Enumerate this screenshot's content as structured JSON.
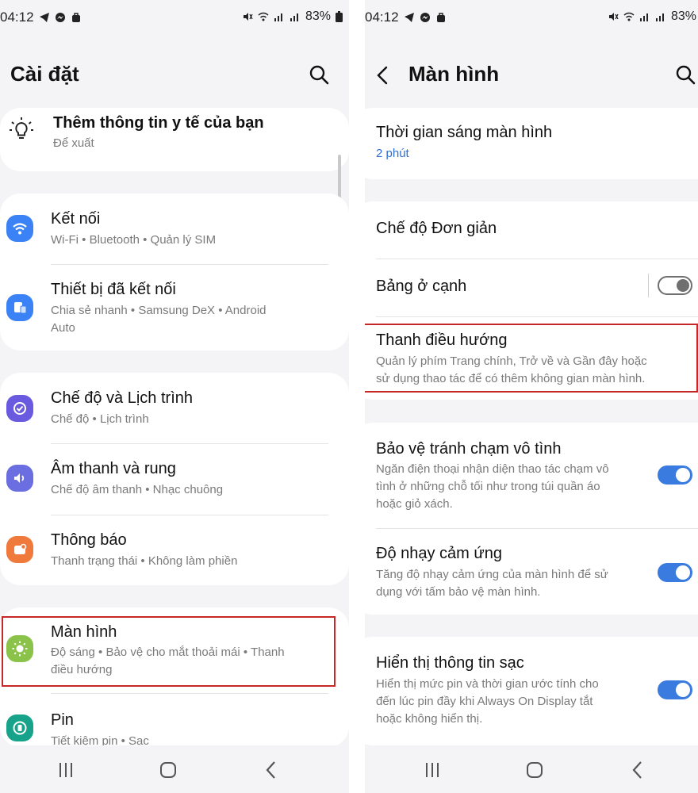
{
  "status": {
    "time": "04:12",
    "battery": "83%"
  },
  "left": {
    "title": "Cài đặt",
    "suggestion": {
      "title": "Thêm thông tin y tế của bạn",
      "sub": "Để xuất"
    },
    "items": [
      {
        "title": "Kết nối",
        "sub": "Wi-Fi  •  Bluetooth  •  Quản lý SIM",
        "color": "#3b82f6"
      },
      {
        "title": "Thiết bị đã kết nối",
        "sub1": "Chia sẻ nhanh  •  Samsung DeX  •  Android",
        "sub2": "Auto",
        "color": "#3b82f6"
      },
      {
        "title": "Chế độ và Lịch trình",
        "sub": "Chế độ  •  Lịch trình",
        "color": "#6a5adf"
      },
      {
        "title": "Âm thanh và rung",
        "sub": "Chế độ âm thanh  •  Nhạc chuông",
        "color": "#6a6ee0"
      },
      {
        "title": "Thông báo",
        "sub": "Thanh trạng thái  •  Không làm phiền",
        "color": "#f07a3c"
      },
      {
        "title": "Màn hình",
        "sub1": "Độ sáng  •  Bảo vệ cho mắt thoải mái  •  Thanh",
        "sub2": "điều hướng",
        "color": "#8bc34a"
      },
      {
        "title": "Pin",
        "sub": "Tiết kiệm pin  •  Sạc",
        "color": "#16a38a"
      }
    ]
  },
  "right": {
    "title": "Màn hình",
    "screen_timeout": {
      "title": "Thời gian sáng màn hình",
      "value": "2 phút"
    },
    "easy_mode": {
      "title": "Chế độ Đơn giản"
    },
    "edge_panels": {
      "title": "Bảng ở cạnh",
      "enabled": false
    },
    "navigation_bar": {
      "title": "Thanh điều hướng",
      "sub1": "Quản lý phím Trang chính, Trở về và Gần đây hoặc",
      "sub2": "sử dụng thao tác để có thêm không gian màn hình."
    },
    "accidental_touch": {
      "title": "Bảo vệ tránh chạm vô tình",
      "sub1": "Ngăn điện thoại nhận diện thao tác chạm vô",
      "sub2": "tình ở những chỗ tối như trong túi quần áo",
      "sub3": "hoặc giỏ xách.",
      "enabled": true
    },
    "touch_sensitivity": {
      "title": "Độ nhạy cảm ứng",
      "sub1": "Tăng độ nhạy cảm ứng của màn hình để sử",
      "sub2": "dụng với tấm bảo vệ màn hình.",
      "enabled": true
    },
    "charging_info": {
      "title": "Hiển thị thông tin sạc",
      "sub1": "Hiển thị mức pin và thời gian ước tính cho",
      "sub2": "đến lúc pin đầy khi Always On Display tắt",
      "sub3": "hoặc không hiển thị.",
      "enabled": true
    }
  },
  "colors": {
    "accent": "#3a7be0",
    "highlight": "#c62828"
  }
}
